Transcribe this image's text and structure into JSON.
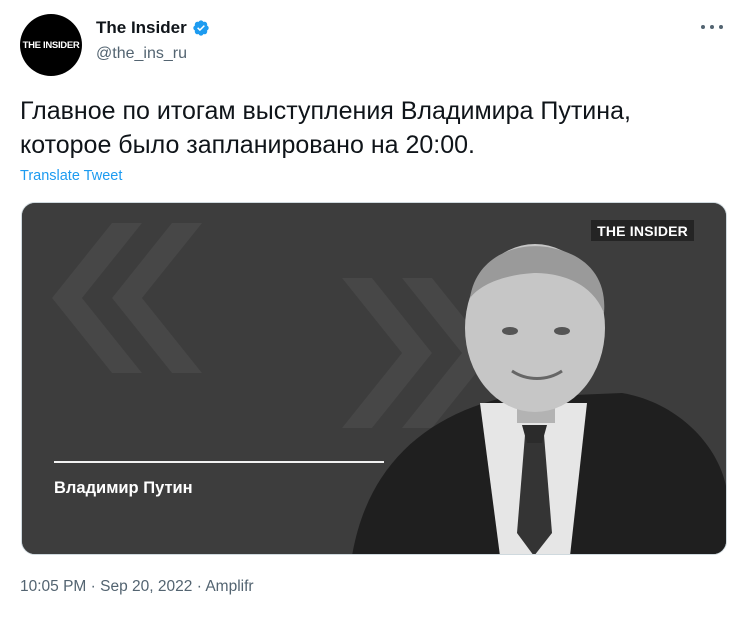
{
  "author": {
    "avatar_text": "THE INSIDER",
    "display_name": "The Insider",
    "handle": "@the_ins_ru",
    "verified": true
  },
  "tweet": {
    "text_line_1": "Главное по итогам выступления Владимира Путина,",
    "text_line_2": "которое было запланировано на 20:00.",
    "translate_label": "Translate Tweet"
  },
  "media": {
    "brand": "THE INSIDER",
    "caption": "Владимир Путин"
  },
  "meta": {
    "time": "10:05 PM",
    "separator": "·",
    "date": "Sep 20, 2022",
    "source": "Amplifr"
  },
  "icons": {
    "verified": "verified-badge-icon",
    "more": "more-options-icon"
  },
  "colors": {
    "accent": "#1d9bf0",
    "secondary_text": "#536471",
    "media_background": "#3d3d3d"
  }
}
